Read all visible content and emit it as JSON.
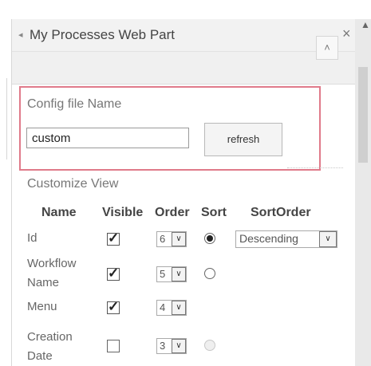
{
  "pane": {
    "title": "My Processes Web Part",
    "title_arrow": "◂",
    "close_icon": "×",
    "collapse_icon": "˄"
  },
  "scroll": {
    "up_icon": "▲"
  },
  "config": {
    "label": "Config file Name",
    "file_value": "custom",
    "refresh_label": "refresh"
  },
  "customize": {
    "label": "Customize View",
    "columns": {
      "name": "Name",
      "visible": "Visible",
      "order": "Order",
      "sort": "Sort",
      "sortorder": "SortOrder"
    },
    "rows": [
      {
        "name": "Id",
        "visible": true,
        "order": "6",
        "sort": "selected",
        "sortorder": "Descending"
      },
      {
        "name_line1": "Workflow",
        "name_line2": "Name",
        "visible": true,
        "order": "5",
        "sort": "empty"
      },
      {
        "name": "Menu",
        "visible": true,
        "order": "4"
      },
      {
        "name_line1": "Creation",
        "name_line2": "Date",
        "visible": false,
        "order": "3",
        "sort": "disabled"
      }
    ],
    "select_arrow": "∨"
  },
  "colors": {
    "accent_border": "#e07a8a"
  }
}
